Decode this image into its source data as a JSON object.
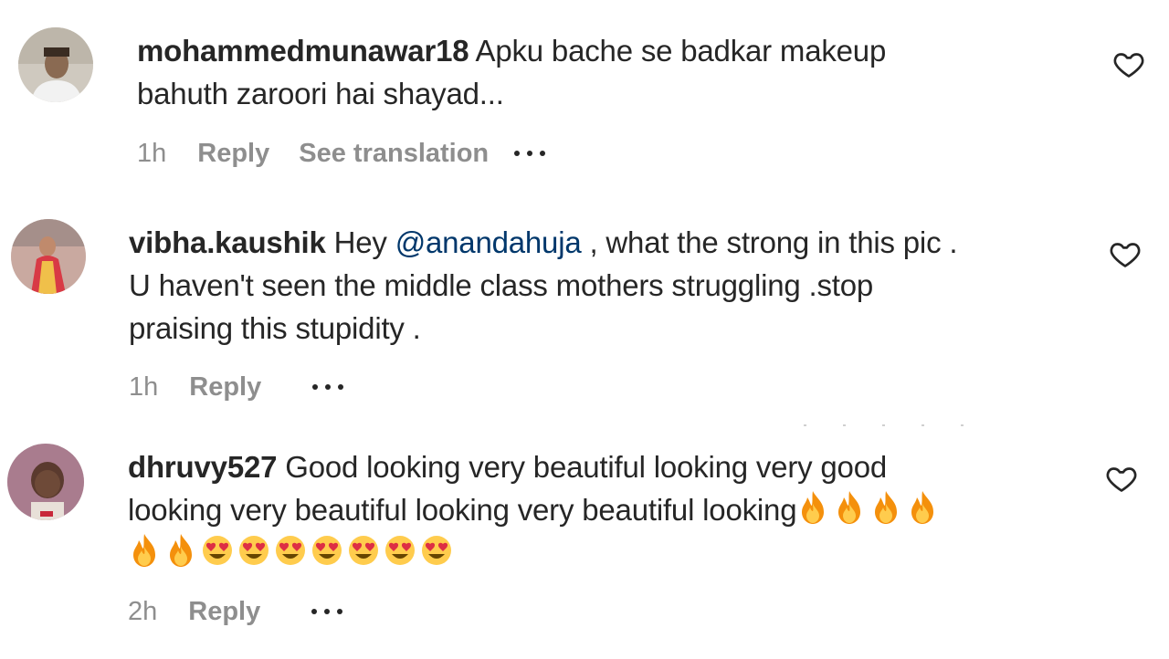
{
  "comments": [
    {
      "username": "mohammedmunawar18",
      "text_lines": [
        "Apku bache se badkar makeup",
        "bahuth zaroori hai shayad..."
      ],
      "time": "1h",
      "reply_label": "Reply",
      "translate_label": "See translation"
    },
    {
      "username": "vibha.kaushik",
      "text_pre": "Hey ",
      "mention": "@anandahuja",
      "text_post": " , what the strong in this pic .",
      "text_lines": [
        "U haven't seen the middle class mothers struggling .stop",
        "praising this stupidity ."
      ],
      "time": "1h",
      "reply_label": "Reply"
    },
    {
      "username": "dhruvy527",
      "text_lines": [
        "Good looking very beautiful looking very good",
        "looking very beautiful looking very beautiful looking"
      ],
      "emoji_line1": [
        "fire",
        "fire",
        "fire",
        "fire"
      ],
      "emoji_line2": [
        "fire",
        "fire",
        "heart-eyes",
        "heart-eyes",
        "heart-eyes",
        "heart-eyes",
        "heart-eyes",
        "heart-eyes",
        "heart-eyes"
      ],
      "time": "2h",
      "reply_label": "Reply"
    }
  ],
  "colors": {
    "text": "#262626",
    "meta": "#8e8e8e",
    "mention": "#00376b"
  }
}
